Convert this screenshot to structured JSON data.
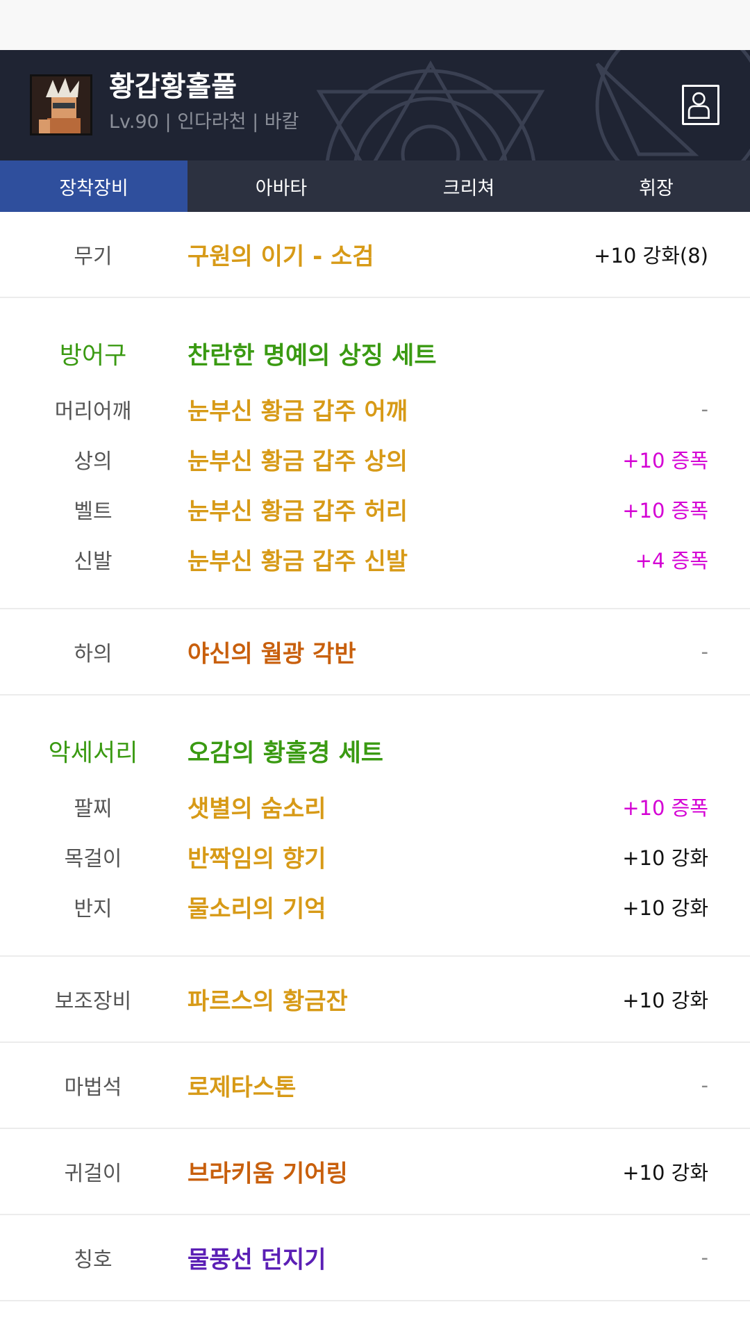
{
  "character": {
    "name": "황갑황홀풀",
    "info": "Lv.90 | 인다라천 | 바칼"
  },
  "tabs": [
    "장착장비",
    "아바타",
    "크리쳐",
    "휘장"
  ],
  "equipment": {
    "weapon": {
      "label": "무기",
      "name": "구원의 이기 - 소검",
      "value": "+10 강화(8)"
    },
    "armor": {
      "label": "방어구",
      "set_name": "찬란한 명예의 상징 세트",
      "items": [
        {
          "label": "머리어깨",
          "name": "눈부신 황금 갑주 어깨",
          "value": "-"
        },
        {
          "label": "상의",
          "name": "눈부신 황금 갑주 상의",
          "value": "+10 증폭"
        },
        {
          "label": "벨트",
          "name": "눈부신 황금 갑주 허리",
          "value": "+10 증폭"
        },
        {
          "label": "신발",
          "name": "눈부신 황금 갑주 신발",
          "value": "+4 증폭"
        }
      ]
    },
    "pants": {
      "label": "하의",
      "name": "야신의 월광 각반",
      "value": "-"
    },
    "accessory": {
      "label": "악세서리",
      "set_name": "오감의 황홀경 세트",
      "items": [
        {
          "label": "팔찌",
          "name": "샛별의 숨소리",
          "value": "+10 증폭"
        },
        {
          "label": "목걸이",
          "name": "반짝임의 향기",
          "value": "+10 강화"
        },
        {
          "label": "반지",
          "name": "물소리의 기억",
          "value": "+10 강화"
        }
      ]
    },
    "sub": {
      "label": "보조장비",
      "name": "파르스의 황금잔",
      "value": "+10 강화"
    },
    "magicstone": {
      "label": "마법석",
      "name": "로제타스톤",
      "value": "-"
    },
    "earring": {
      "label": "귀걸이",
      "name": "브라키움 기어링",
      "value": "+10 강화"
    },
    "title": {
      "label": "칭호",
      "name": "물풍선 던지기",
      "value": "-"
    }
  },
  "colors": {
    "legendary": "#d79a17",
    "epic_brown": "#c85f0c",
    "unique_purple": "#5b1fb5",
    "set_green": "#3a9a12",
    "amplify_magenta": "#d400d4",
    "active_tab": "#2f4f9d"
  },
  "icons": {
    "profile": "person-icon"
  }
}
